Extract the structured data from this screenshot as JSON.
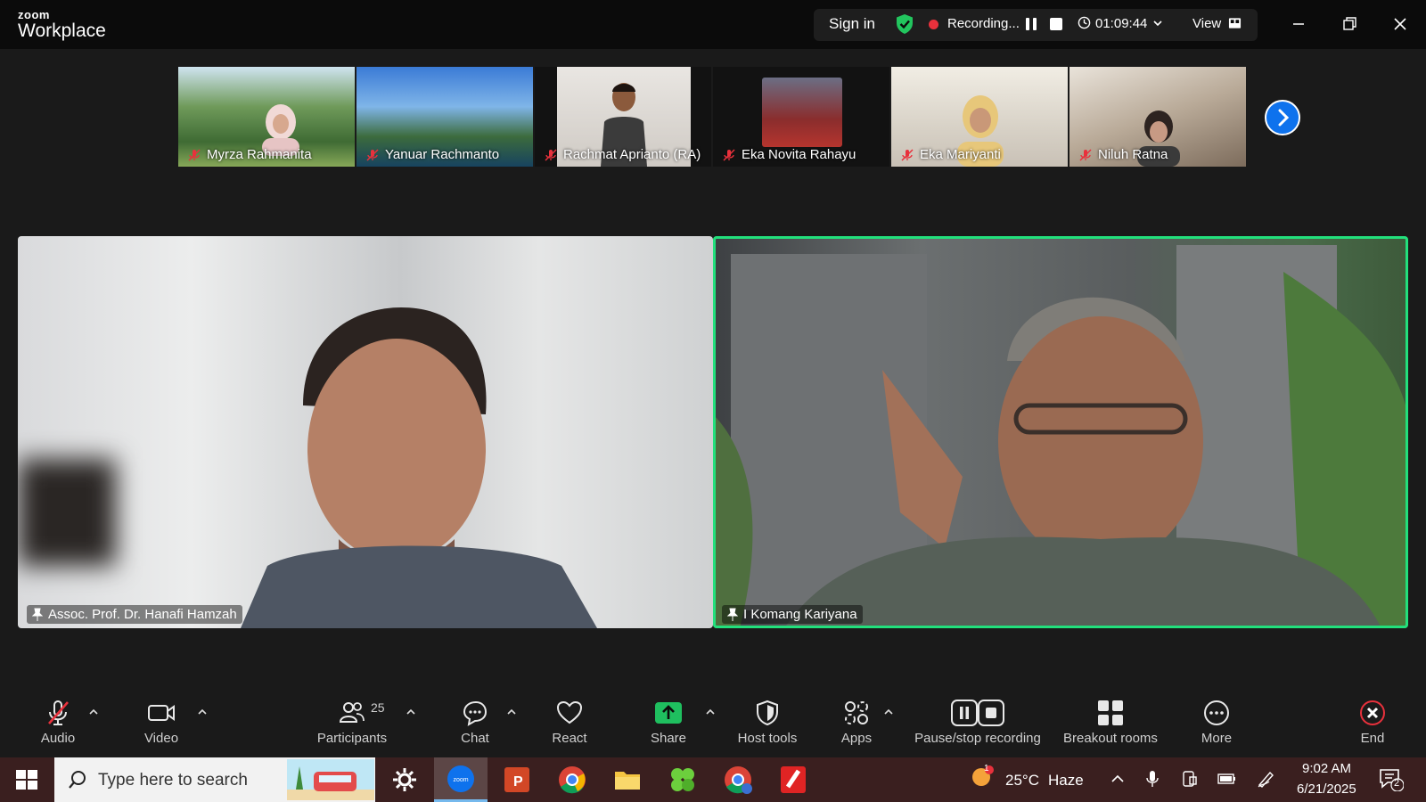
{
  "app": {
    "brand_small": "zoom",
    "brand_large": "Workplace",
    "sign_in": "Sign in",
    "recording_label": "Recording...",
    "timer": "01:09:44",
    "view_label": "View"
  },
  "thumbnails": [
    {
      "name": "Myrza Rahmanita"
    },
    {
      "name": "Yanuar Rachmanto"
    },
    {
      "name": "Rachmat Aprianto (RA)"
    },
    {
      "name": "Eka Novita Rahayu"
    },
    {
      "name": "Eka Mariyanti"
    },
    {
      "name": "Niluh Ratna"
    }
  ],
  "main_tiles": [
    {
      "name": "Assoc. Prof. Dr. Hanafi Hamzah"
    },
    {
      "name": "I Komang Kariyana"
    }
  ],
  "controls": {
    "audio": "Audio",
    "video": "Video",
    "participants": "Participants",
    "participants_count": "25",
    "chat": "Chat",
    "react": "React",
    "share": "Share",
    "host_tools": "Host tools",
    "apps": "Apps",
    "pause_stop_recording": "Pause/stop recording",
    "breakout_rooms": "Breakout rooms",
    "more": "More",
    "end": "End"
  },
  "taskbar": {
    "search_placeholder": "Type here to search",
    "weather_temp": "25°C",
    "weather_desc": "Haze",
    "time": "9:02 AM",
    "date": "6/21/2025",
    "notification_count": "2",
    "weather_badge": "1"
  },
  "colors": {
    "active_speaker": "#22e07c",
    "record_red": "#e8313c",
    "share_green": "#1fbf5f",
    "zoom_blue": "#0e72ed"
  }
}
